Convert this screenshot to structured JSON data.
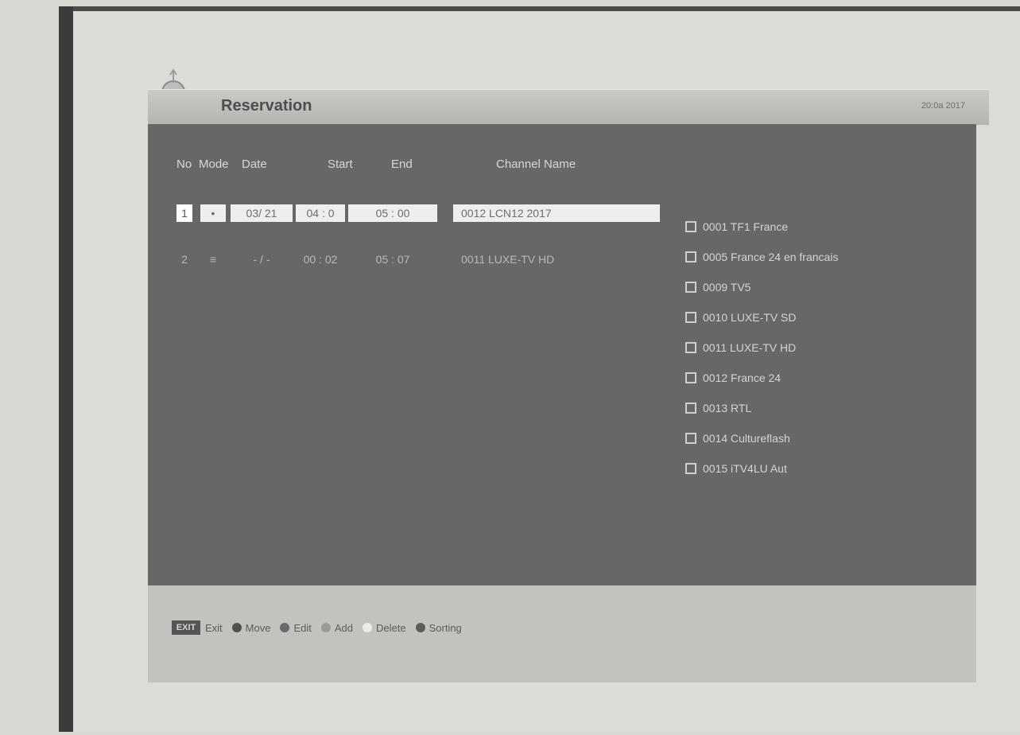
{
  "window": {
    "title": "Reservation",
    "clock": "20:0a 2017"
  },
  "columns": [
    "No",
    "Mode",
    "Date",
    "Start",
    "End",
    "Channel Name"
  ],
  "reservations": [
    {
      "no": "1",
      "mode": "•",
      "date": "03/ 21",
      "start": "04 : 0",
      "end": "05 : 00",
      "channel": "0012 LCN12 2017"
    },
    {
      "no": "2",
      "mode": "≡",
      "date": "- / -",
      "start": "00 : 02",
      "end": "05 : 07",
      "channel": "0011 LUXE-TV HD"
    }
  ],
  "channels": [
    "0001 TF1 France",
    "0005 France 24 en francais",
    "0009 TV5",
    "0010 LUXE-TV SD",
    "0011 LUXE-TV HD",
    "0012 France 24",
    "0013 RTL",
    "0014 Cultureflash",
    "0015 iTV4LU Aut"
  ],
  "footer": {
    "ok_key": "EXIT",
    "items": [
      {
        "label": "Exit",
        "dot": "none"
      },
      {
        "label": "Move",
        "dot": "d1"
      },
      {
        "label": "Edit",
        "dot": "d2"
      },
      {
        "label": "Add",
        "dot": "d3"
      },
      {
        "label": "Delete",
        "dot": "d4"
      },
      {
        "label": "Sorting",
        "dot": "d5"
      }
    ]
  }
}
